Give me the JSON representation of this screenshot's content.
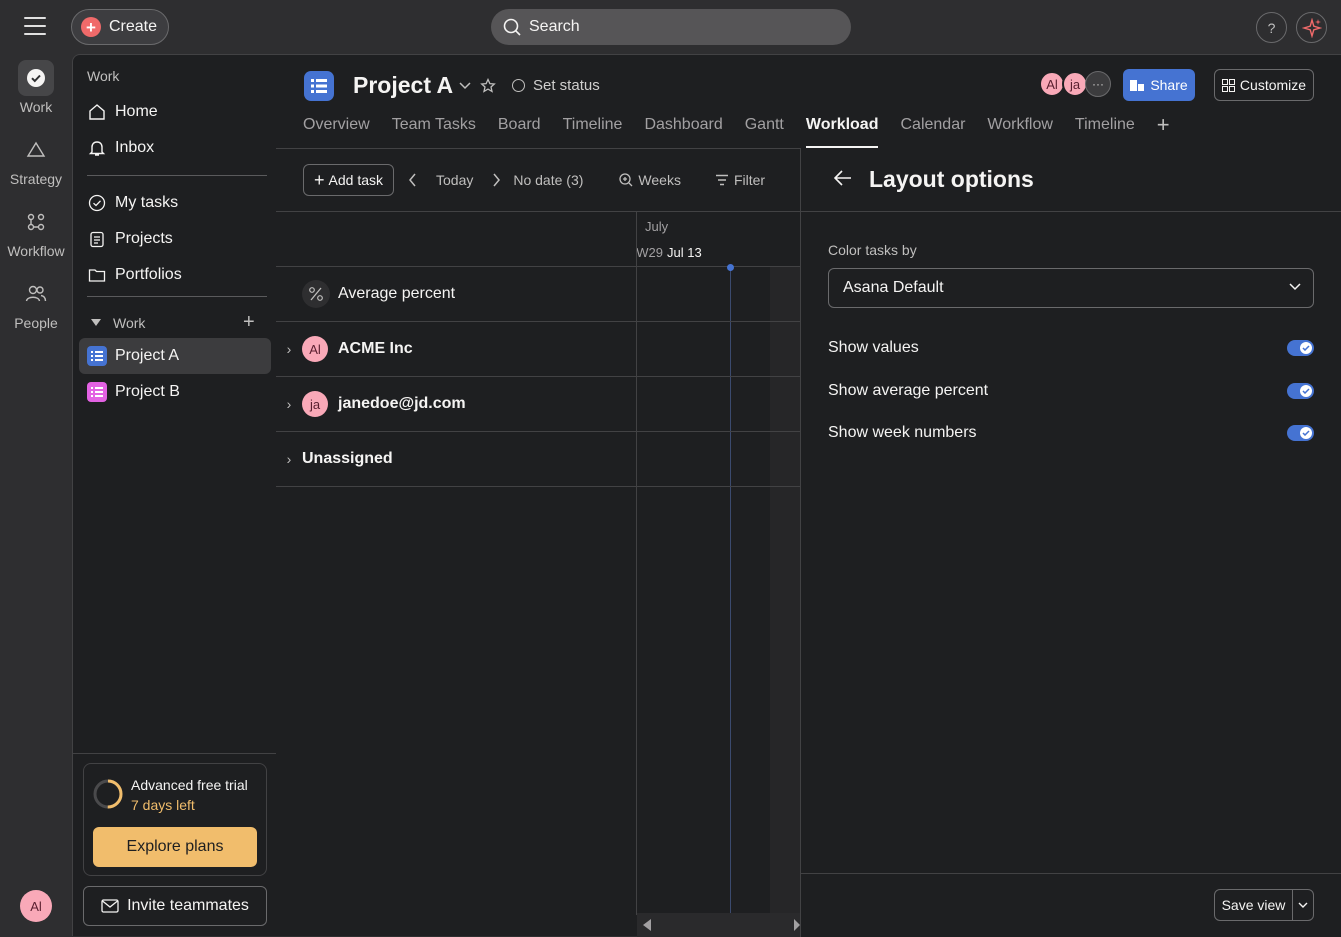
{
  "topbar": {
    "create_label": "Create",
    "search_placeholder": "Search",
    "help_label": "?"
  },
  "rail": {
    "items": [
      {
        "label": "Work"
      },
      {
        "label": "Strategy"
      },
      {
        "label": "Workflow"
      },
      {
        "label": "People"
      }
    ],
    "user_initials": "Al"
  },
  "sidebar": {
    "section_title": "Work",
    "nav": [
      {
        "label": "Home"
      },
      {
        "label": "Inbox"
      }
    ],
    "personal": [
      {
        "label": "My tasks"
      },
      {
        "label": "Projects"
      },
      {
        "label": "Portfolios"
      }
    ],
    "work_group_label": "Work",
    "projects": [
      {
        "label": "Project A",
        "color": "#4573d2"
      },
      {
        "label": "Project B",
        "color": "#e362e3"
      }
    ],
    "trial": {
      "title": "Advanced free trial",
      "days_left": "7 days left",
      "progress": 0.5,
      "cta": "Explore plans"
    },
    "invite_label": "Invite teammates"
  },
  "project": {
    "title": "Project A",
    "set_status": "Set status",
    "members": [
      "Al",
      "ja"
    ],
    "share_label": "Share",
    "customize_label": "Customize",
    "tabs": [
      {
        "label": "Overview"
      },
      {
        "label": "Team Tasks"
      },
      {
        "label": "Board"
      },
      {
        "label": "Timeline"
      },
      {
        "label": "Dashboard"
      },
      {
        "label": "Gantt"
      },
      {
        "label": "Workload",
        "active": true
      },
      {
        "label": "Calendar"
      },
      {
        "label": "Workflow"
      },
      {
        "label": "Timeline"
      }
    ]
  },
  "toolbar": {
    "add_task": "Add task",
    "today": "Today",
    "no_date": "No date (3)",
    "weeks": "Weeks",
    "filter": "Filter"
  },
  "timeline": {
    "month": "July",
    "week_prev": "W29",
    "week_label": "Jul 13"
  },
  "rows": [
    {
      "label": "Average percent"
    },
    {
      "label": "ACME Inc",
      "initials": "Al"
    },
    {
      "label": "janedoe@jd.com",
      "initials": "ja"
    },
    {
      "label": "Unassigned"
    }
  ],
  "panel": {
    "title": "Layout options",
    "color_label": "Color tasks by",
    "color_value": "Asana Default",
    "options": [
      {
        "label": "Show values",
        "on": true
      },
      {
        "label": "Show average percent",
        "on": true
      },
      {
        "label": "Show week numbers",
        "on": true
      }
    ],
    "save_view": "Save view"
  },
  "colors": {
    "accent": "#4573d2",
    "create": "#f06a6a",
    "trial": "#f1bd6c"
  }
}
